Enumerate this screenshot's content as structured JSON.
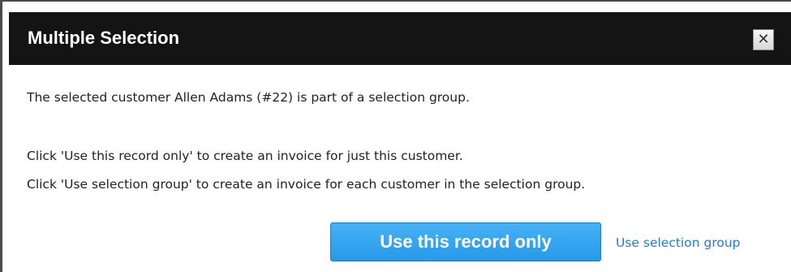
{
  "dialog": {
    "title": "Multiple Selection",
    "close_label": "✕",
    "messages": [
      "The selected customer Allen Adams (#22) is part of a selection group.",
      "Click 'Use this record only' to create an invoice for just this customer.",
      "Click 'Use selection group' to create an invoice for each customer in the selection group."
    ],
    "primary_button": "Use this record only",
    "secondary_link": "Use selection group"
  },
  "colors": {
    "titlebar": "#141414",
    "primary_button": "#2ba2ee",
    "link": "#1e7fd0"
  }
}
